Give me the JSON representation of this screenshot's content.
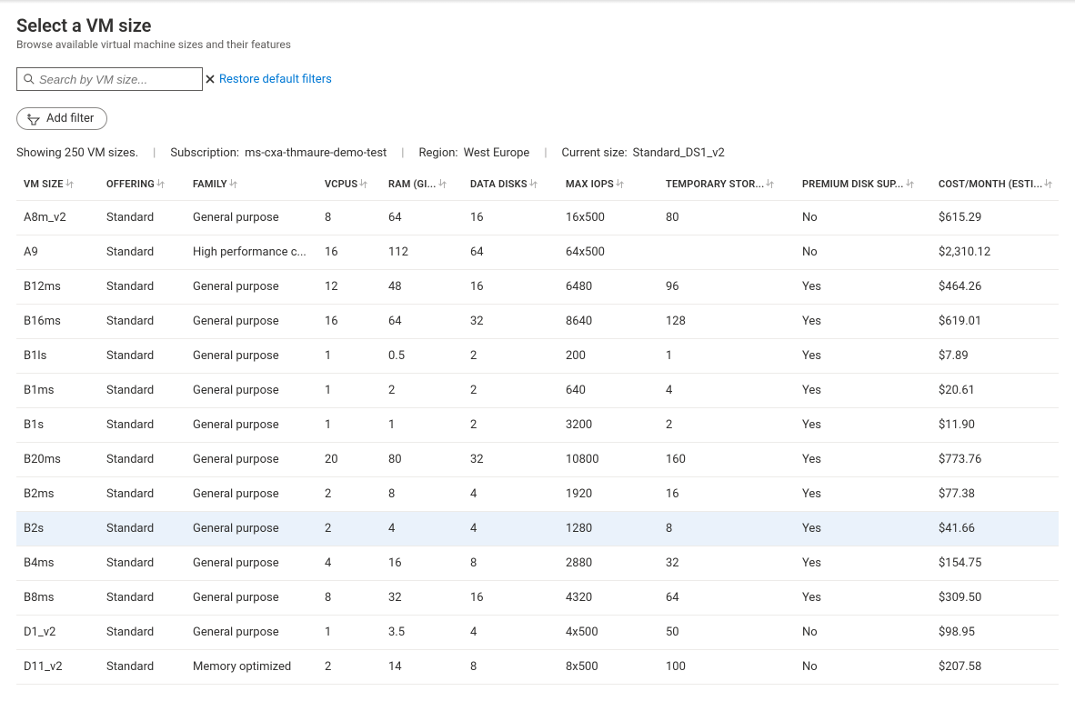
{
  "header": {
    "title": "Select a VM size",
    "subtitle": "Browse available virtual machine sizes and their features"
  },
  "search": {
    "placeholder": "Search by VM size..."
  },
  "links": {
    "restore_filters": "Restore default filters"
  },
  "add_filter_label": "Add filter",
  "status": {
    "showing": "Showing 250 VM sizes.",
    "subscription_label": "Subscription:",
    "subscription_value": "ms-cxa-thmaure-demo-test",
    "region_label": "Region:",
    "region_value": "West Europe",
    "current_size_label": "Current size:",
    "current_size_value": "Standard_DS1_v2"
  },
  "columns": [
    "VM SIZE",
    "OFFERING",
    "FAMILY",
    "VCPUS",
    "RAM (GI...",
    "DATA DISKS",
    "MAX IOPS",
    "TEMPORARY STOR...",
    "PREMIUM DISK SUP...",
    "COST/MONTH (ESTI..."
  ],
  "rows": [
    {
      "vmsize": "A8m_v2",
      "offering": "Standard",
      "family": "General purpose",
      "vcpus": "8",
      "ram": "64",
      "disks": "16",
      "iops": "16x500",
      "temp": "80",
      "premium": "No",
      "cost": "$615.29",
      "selected": false
    },
    {
      "vmsize": "A9",
      "offering": "Standard",
      "family": "High performance c...",
      "vcpus": "16",
      "ram": "112",
      "disks": "64",
      "iops": "64x500",
      "temp": "",
      "premium": "No",
      "cost": "$2,310.12",
      "selected": false
    },
    {
      "vmsize": "B12ms",
      "offering": "Standard",
      "family": "General purpose",
      "vcpus": "12",
      "ram": "48",
      "disks": "16",
      "iops": "6480",
      "temp": "96",
      "premium": "Yes",
      "cost": "$464.26",
      "selected": false
    },
    {
      "vmsize": "B16ms",
      "offering": "Standard",
      "family": "General purpose",
      "vcpus": "16",
      "ram": "64",
      "disks": "32",
      "iops": "8640",
      "temp": "128",
      "premium": "Yes",
      "cost": "$619.01",
      "selected": false
    },
    {
      "vmsize": "B1ls",
      "offering": "Standard",
      "family": "General purpose",
      "vcpus": "1",
      "ram": "0.5",
      "disks": "2",
      "iops": "200",
      "temp": "1",
      "premium": "Yes",
      "cost": "$7.89",
      "selected": false
    },
    {
      "vmsize": "B1ms",
      "offering": "Standard",
      "family": "General purpose",
      "vcpus": "1",
      "ram": "2",
      "disks": "2",
      "iops": "640",
      "temp": "4",
      "premium": "Yes",
      "cost": "$20.61",
      "selected": false
    },
    {
      "vmsize": "B1s",
      "offering": "Standard",
      "family": "General purpose",
      "vcpus": "1",
      "ram": "1",
      "disks": "2",
      "iops": "3200",
      "temp": "2",
      "premium": "Yes",
      "cost": "$11.90",
      "selected": false
    },
    {
      "vmsize": "B20ms",
      "offering": "Standard",
      "family": "General purpose",
      "vcpus": "20",
      "ram": "80",
      "disks": "32",
      "iops": "10800",
      "temp": "160",
      "premium": "Yes",
      "cost": "$773.76",
      "selected": false
    },
    {
      "vmsize": "B2ms",
      "offering": "Standard",
      "family": "General purpose",
      "vcpus": "2",
      "ram": "8",
      "disks": "4",
      "iops": "1920",
      "temp": "16",
      "premium": "Yes",
      "cost": "$77.38",
      "selected": false
    },
    {
      "vmsize": "B2s",
      "offering": "Standard",
      "family": "General purpose",
      "vcpus": "2",
      "ram": "4",
      "disks": "4",
      "iops": "1280",
      "temp": "8",
      "premium": "Yes",
      "cost": "$41.66",
      "selected": true
    },
    {
      "vmsize": "B4ms",
      "offering": "Standard",
      "family": "General purpose",
      "vcpus": "4",
      "ram": "16",
      "disks": "8",
      "iops": "2880",
      "temp": "32",
      "premium": "Yes",
      "cost": "$154.75",
      "selected": false
    },
    {
      "vmsize": "B8ms",
      "offering": "Standard",
      "family": "General purpose",
      "vcpus": "8",
      "ram": "32",
      "disks": "16",
      "iops": "4320",
      "temp": "64",
      "premium": "Yes",
      "cost": "$309.50",
      "selected": false
    },
    {
      "vmsize": "D1_v2",
      "offering": "Standard",
      "family": "General purpose",
      "vcpus": "1",
      "ram": "3.5",
      "disks": "4",
      "iops": "4x500",
      "temp": "50",
      "premium": "No",
      "cost": "$98.95",
      "selected": false
    },
    {
      "vmsize": "D11_v2",
      "offering": "Standard",
      "family": "Memory optimized",
      "vcpus": "2",
      "ram": "14",
      "disks": "8",
      "iops": "8x500",
      "temp": "100",
      "premium": "No",
      "cost": "$207.58",
      "selected": false
    }
  ]
}
